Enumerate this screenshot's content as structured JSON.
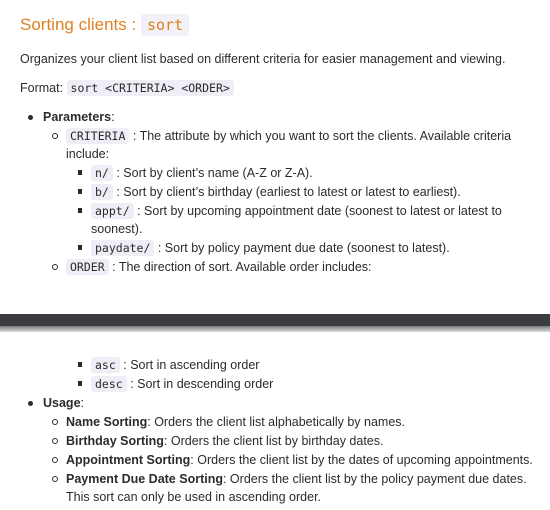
{
  "top": {
    "title_text": "Sorting clients : ",
    "title_code": "sort",
    "intro": "Organizes your client list based on different criteria for easier management and viewing.",
    "format_label": "Format: ",
    "format_code": "sort <CRITERIA> <ORDER>",
    "parameters_label": "Parameters",
    "criteria_code": "CRITERIA",
    "criteria_desc": " : The attribute by which you want to sort the clients. Available criteria include:",
    "criteria_items": [
      {
        "code": "n/",
        "desc": " : Sort by client’s name (A-Z or Z-A)."
      },
      {
        "code": "b/",
        "desc": " : Sort by client’s birthday (earliest to latest or latest to earliest)."
      },
      {
        "code": "appt/",
        "desc": " : Sort by upcoming appointment date (soonest to latest or latest to soonest)."
      },
      {
        "code": "paydate/",
        "desc": " : Sort by policy payment due date (soonest to latest)."
      }
    ],
    "order_code": "ORDER",
    "order_desc": " : The direction of sort. Available order includes:"
  },
  "bottom": {
    "order_items": [
      {
        "code": "asc",
        "desc": " : Sort in ascending order"
      },
      {
        "code": "desc",
        "desc": " : Sort in descending order"
      }
    ],
    "usage_label": "Usage",
    "usage_items": [
      {
        "bold": "Name Sorting",
        "desc": ": Orders the client list alphabetically by names."
      },
      {
        "bold": "Birthday Sorting",
        "desc": ": Orders the client list by birthday dates."
      },
      {
        "bold": "Appointment Sorting",
        "desc": ": Orders the client list by the dates of upcoming appointments."
      },
      {
        "bold": "Payment Due Date Sorting",
        "desc": ": Orders the client list by the policy payment due dates. This sort can only be used in ascending order."
      }
    ]
  }
}
